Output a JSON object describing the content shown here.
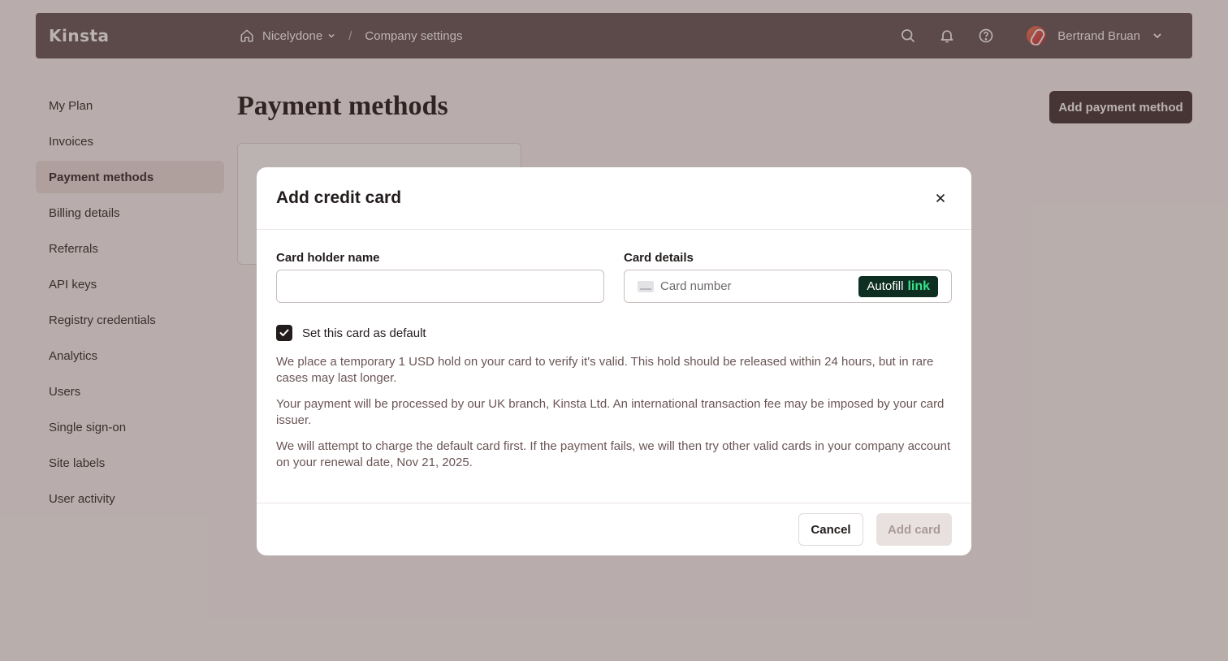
{
  "topbar": {
    "logo": "Kinsta",
    "breadcrumb": {
      "company": "Nicelydone",
      "separator": "/",
      "current": "Company settings"
    },
    "icons": [
      "home-icon",
      "search-icon",
      "bell-icon",
      "help-icon",
      "chevron-down-icon"
    ],
    "user_name": "Bertrand Bruan"
  },
  "sidebar": {
    "items": [
      {
        "label": "My Plan"
      },
      {
        "label": "Invoices"
      },
      {
        "label": "Payment methods",
        "active": true
      },
      {
        "label": "Billing details"
      },
      {
        "label": "Referrals"
      },
      {
        "label": "API keys"
      },
      {
        "label": "Registry credentials"
      },
      {
        "label": "Analytics"
      },
      {
        "label": "Users"
      },
      {
        "label": "Single sign-on"
      },
      {
        "label": "Site labels"
      },
      {
        "label": "User activity"
      }
    ]
  },
  "page": {
    "title": "Payment methods",
    "add_button": "Add payment method"
  },
  "modal": {
    "title": "Add credit card",
    "card_holder_label": "Card holder name",
    "card_holder_value": "",
    "card_details_label": "Card details",
    "card_number_placeholder": "Card number",
    "autofill_text": "Autofill",
    "autofill_brand": "link",
    "default_checkbox_label": "Set this card as default",
    "default_checked": true,
    "info": [
      "We place a temporary 1 USD hold on your card to verify it's valid. This hold should be released within 24 hours, but in rare cases may last longer.",
      "Your payment will be processed by our UK branch, Kinsta Ltd. An international transaction fee may be imposed by your card issuer.",
      "We will attempt to charge the default card first. If the payment fails, we will then try other valid cards in your company account on your renewal date, Nov 21, 2025."
    ],
    "cancel_label": "Cancel",
    "submit_label": "Add card"
  },
  "colors": {
    "topbar": "#6e5f5f",
    "primary_button": "#4d3f3f",
    "overlay": "rgba(60,35,35,0.35)",
    "link_green": "#37e38a"
  }
}
